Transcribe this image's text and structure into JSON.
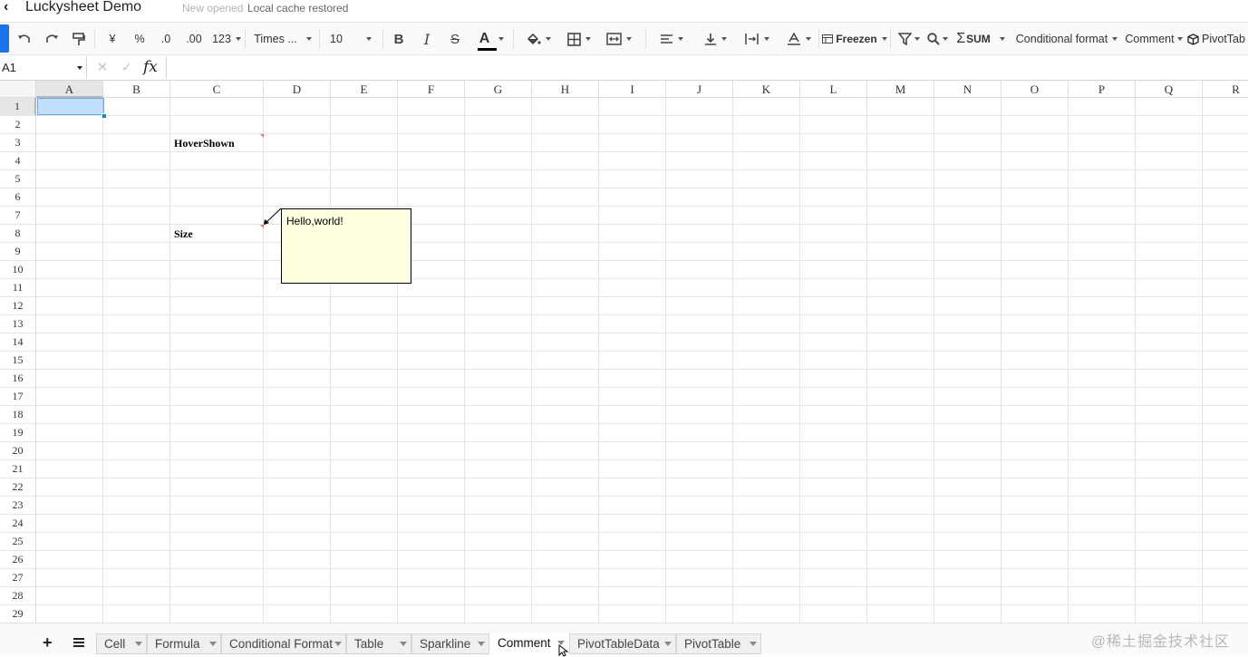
{
  "app": {
    "title": "Luckysheet Demo",
    "status_new": "New opened",
    "status_cache": "Local cache restored"
  },
  "toolbar": {
    "undo": "undo-icon",
    "redo": "redo-icon",
    "format_painter": "format-painter-icon",
    "currency": "¥",
    "percent": "%",
    "decrease_decimal": ".0",
    "increase_decimal": ".00",
    "number_format": "123",
    "font_family": "Times ...",
    "font_size": "10",
    "bold": "B",
    "italic": "I",
    "strike": "S",
    "text_color_label": "A",
    "text_color": "#000000",
    "freeze": "Freezen",
    "sum": "SUM",
    "conditional_format": "Conditional format",
    "comment": "Comment",
    "pivot": "PivotTab"
  },
  "formula_bar": {
    "cell_ref": "A1",
    "cancel": "✕",
    "confirm": "✓",
    "fx": "fx",
    "value": ""
  },
  "grid": {
    "columns": [
      "A",
      "B",
      "C",
      "D",
      "E",
      "F",
      "G",
      "H",
      "I",
      "J",
      "K",
      "L",
      "M",
      "N",
      "O",
      "P",
      "Q",
      "R"
    ],
    "rows": [
      "1",
      "2",
      "3",
      "4",
      "5",
      "6",
      "7",
      "8",
      "9",
      "10",
      "11",
      "12",
      "13",
      "14",
      "15",
      "16",
      "17",
      "18",
      "19",
      "20",
      "21",
      "22",
      "23",
      "24",
      "25",
      "26",
      "27",
      "28",
      "29"
    ],
    "active_cell": "A1",
    "cells": {
      "C3": "HoverShown",
      "C8": "Size"
    },
    "comment_popup": "Hello,world!"
  },
  "sheets": {
    "add": "+",
    "tabs": [
      "Cell",
      "Formula",
      "Conditional Format",
      "Table",
      "Sparkline",
      "Comment",
      "PivotTableData",
      "PivotTable"
    ],
    "active": "Comment"
  },
  "watermark": "@稀土掘金技术社区",
  "colors": {
    "accent": "#1a73e8",
    "selection": "#0188fb",
    "comment_bg": "#ffffe1",
    "comment_marker": "#fc6666"
  }
}
